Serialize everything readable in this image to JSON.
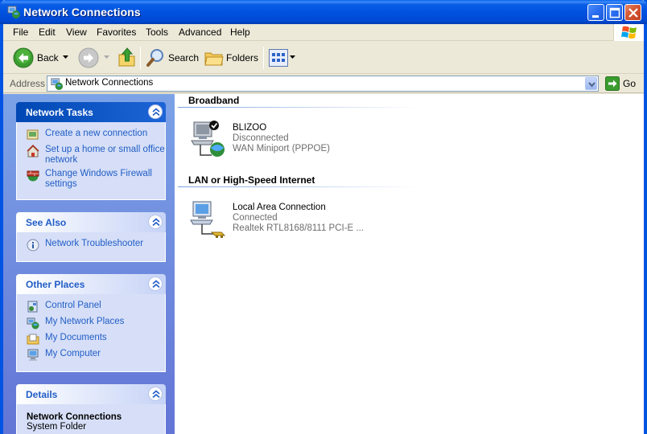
{
  "window": {
    "title": "Network Connections"
  },
  "menu": [
    "File",
    "Edit",
    "View",
    "Favorites",
    "Tools",
    "Advanced",
    "Help"
  ],
  "toolbar": {
    "back_label": "Back",
    "search_label": "Search",
    "folders_label": "Folders"
  },
  "address": {
    "label": "Address",
    "value": "Network Connections",
    "go_label": "Go"
  },
  "sidebar": {
    "network_tasks": {
      "title": "Network Tasks",
      "items": [
        {
          "label": "Create a new connection",
          "icon": "new-connection-icon"
        },
        {
          "label": "Set up a home or small office network",
          "icon": "home-network-icon"
        },
        {
          "label": "Change Windows Firewall settings",
          "icon": "firewall-icon"
        }
      ]
    },
    "see_also": {
      "title": "See Also",
      "items": [
        {
          "label": "Network Troubleshooter",
          "icon": "help-icon"
        }
      ]
    },
    "other_places": {
      "title": "Other Places",
      "items": [
        {
          "label": "Control Panel",
          "icon": "control-panel-icon"
        },
        {
          "label": "My Network Places",
          "icon": "network-places-icon"
        },
        {
          "label": "My Documents",
          "icon": "documents-icon"
        },
        {
          "label": "My Computer",
          "icon": "computer-icon"
        }
      ]
    },
    "details": {
      "title": "Details",
      "name": "Network Connections",
      "type": "System Folder"
    }
  },
  "groups": [
    {
      "title": "Broadband",
      "connections": [
        {
          "name": "BLIZOO",
          "status": "Disconnected",
          "device": "WAN Miniport (PPPOE)",
          "icon": "broadband-connection-icon"
        }
      ]
    },
    {
      "title": "LAN or High-Speed Internet",
      "connections": [
        {
          "name": "Local Area Connection",
          "status": "Connected",
          "device": "Realtek RTL8168/8111 PCI-E ...",
          "icon": "lan-connection-icon"
        }
      ]
    }
  ],
  "colors": {
    "titlebar": "#0054e3",
    "link": "#215dc6",
    "sidebar_top": "#7ba2e7",
    "sidebar_bottom": "#6375d6"
  }
}
